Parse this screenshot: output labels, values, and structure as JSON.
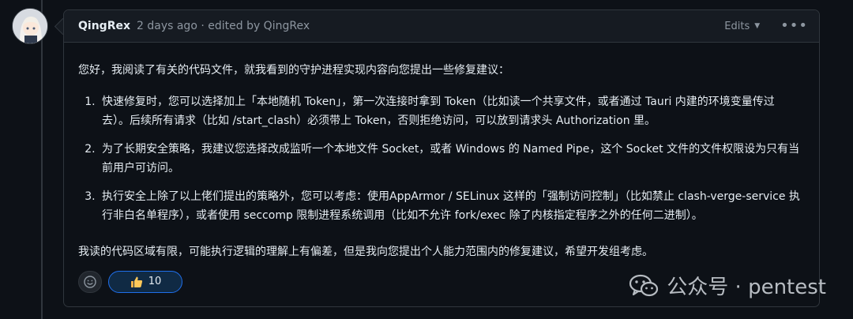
{
  "comment": {
    "author": "QingRex",
    "meta": "2 days ago · edited by QingRex",
    "edits_label": "Edits",
    "intro": "您好，我阅读了有关的代码文件，就我看到的守护进程实现内容向您提出一些修复建议：",
    "items": [
      {
        "text": "快速修复时，您可以选择加上「本地随机 Token」，第一次连接时拿到 Token（比如读一个共享文件，或者通过 Tauri 内建的环境变量传过去）。后续所有请求（比如 /start_clash）必须带上 Token，否则拒绝访问，可以放到请求头 Authorization 里。"
      },
      {
        "text": "为了长期安全策略，我建议您选择改成监听一个本地文件 Socket，或者 Windows 的 Named Pipe，这个 Socket 文件的文件权限设为只有当前用户可访问。"
      },
      {
        "text": "执行安全上除了以上佬们提出的策略外，您可以考虑：使用AppArmor / SELinux 这样的「强制访问控制」（比如禁止 clash-verge-service 执行非白名单程序），或者使用 seccomp 限制进程系统调用（比如不允许 fork/exec 除了内核指定程序之外的任何二进制）。"
      }
    ],
    "closing": "我读的代码区域有限，可能执行逻辑的理解上有偏差，但是我向您提出个人能力范围内的修复建议，希望开发组考虑。",
    "reactions": {
      "thumbs_up_count": "10"
    }
  },
  "watermark": {
    "text": "公众号 · pentest"
  },
  "icons": {
    "add_reaction": "smiley-icon",
    "thumbs_up": "thumbs-up-icon",
    "menu": "kebab-menu-icon",
    "wechat": "wechat-icon"
  }
}
